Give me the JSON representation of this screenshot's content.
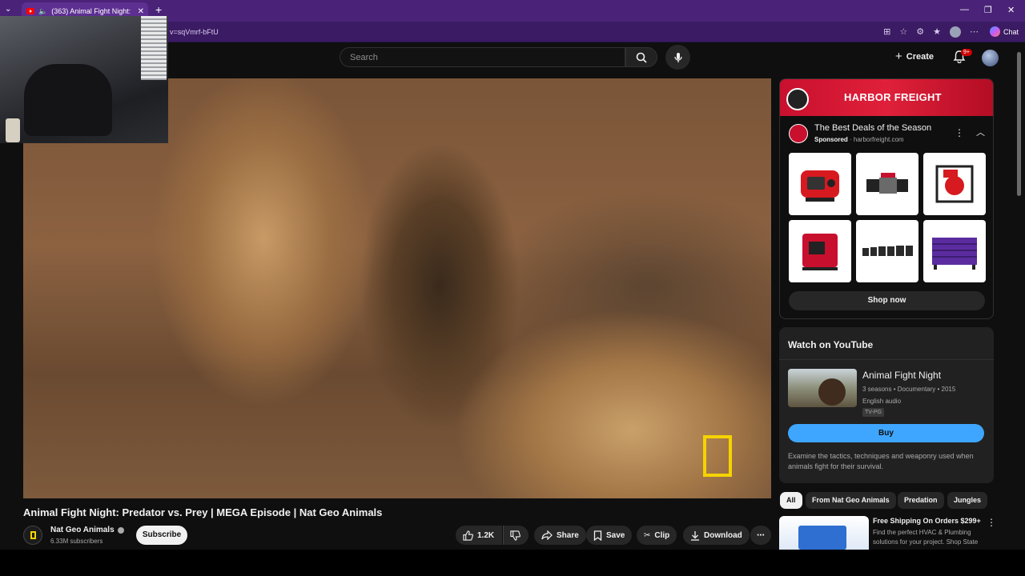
{
  "browser": {
    "tab_title": "(363) Animal Fight Night: Pred",
    "url": "v=sqVmrf-bFtU",
    "chat_label": "Chat"
  },
  "masthead": {
    "search_placeholder": "Search",
    "create_label": "Create",
    "notification_badge": "9+"
  },
  "video": {
    "title": "Animal Fight Night: Predator vs. Prey | MEGA Episode | Nat Geo Animals",
    "channel": "Nat Geo Animals",
    "subscribers": "6.33M subscribers",
    "subscribe_label": "Subscribe",
    "likes": "1.2K",
    "share_label": "Share",
    "save_label": "Save",
    "clip_label": "Clip",
    "download_label": "Download"
  },
  "ad": {
    "banner_text": "HARBOR FREIGHT",
    "title": "The Best Deals of the Season",
    "sponsored_label": "Sponsored",
    "domain": "harborfreight.com",
    "shop_now_label": "Shop now",
    "products": [
      "red-generator",
      "winch",
      "water-pump",
      "inverter-generator",
      "socket-set",
      "tool-chest"
    ]
  },
  "watch": {
    "heading": "Watch on YouTube",
    "title": "Animal Fight Night",
    "meta": "3 seasons • Documentary • 2015",
    "audio": "English audio",
    "rating": "TV-PG",
    "buy_label": "Buy",
    "description": "Examine the tactics, techniques and weaponry used when animals fight for their survival."
  },
  "chips": [
    "All",
    "From Nat Geo Animals",
    "Predation",
    "Jungles"
  ],
  "ad2": {
    "title": "Free Shipping On Orders $299+",
    "description": "Find the perfect HVAC & Plumbing solutions for your project. Shop State"
  },
  "colors": {
    "accent_blue": "#3ea6ff",
    "brand_red": "#c8102e",
    "natgeo_yellow": "#f5d300",
    "browser_purple": "#4a2378"
  }
}
